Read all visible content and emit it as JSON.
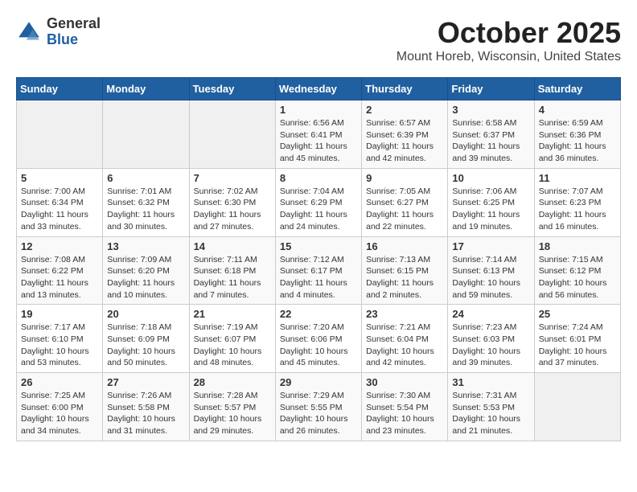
{
  "header": {
    "logo_line1": "General",
    "logo_line2": "Blue",
    "month_title": "October 2025",
    "location": "Mount Horeb, Wisconsin, United States"
  },
  "days_of_week": [
    "Sunday",
    "Monday",
    "Tuesday",
    "Wednesday",
    "Thursday",
    "Friday",
    "Saturday"
  ],
  "weeks": [
    [
      {
        "day": "",
        "info": ""
      },
      {
        "day": "",
        "info": ""
      },
      {
        "day": "",
        "info": ""
      },
      {
        "day": "1",
        "info": "Sunrise: 6:56 AM\nSunset: 6:41 PM\nDaylight: 11 hours\nand 45 minutes."
      },
      {
        "day": "2",
        "info": "Sunrise: 6:57 AM\nSunset: 6:39 PM\nDaylight: 11 hours\nand 42 minutes."
      },
      {
        "day": "3",
        "info": "Sunrise: 6:58 AM\nSunset: 6:37 PM\nDaylight: 11 hours\nand 39 minutes."
      },
      {
        "day": "4",
        "info": "Sunrise: 6:59 AM\nSunset: 6:36 PM\nDaylight: 11 hours\nand 36 minutes."
      }
    ],
    [
      {
        "day": "5",
        "info": "Sunrise: 7:00 AM\nSunset: 6:34 PM\nDaylight: 11 hours\nand 33 minutes."
      },
      {
        "day": "6",
        "info": "Sunrise: 7:01 AM\nSunset: 6:32 PM\nDaylight: 11 hours\nand 30 minutes."
      },
      {
        "day": "7",
        "info": "Sunrise: 7:02 AM\nSunset: 6:30 PM\nDaylight: 11 hours\nand 27 minutes."
      },
      {
        "day": "8",
        "info": "Sunrise: 7:04 AM\nSunset: 6:29 PM\nDaylight: 11 hours\nand 24 minutes."
      },
      {
        "day": "9",
        "info": "Sunrise: 7:05 AM\nSunset: 6:27 PM\nDaylight: 11 hours\nand 22 minutes."
      },
      {
        "day": "10",
        "info": "Sunrise: 7:06 AM\nSunset: 6:25 PM\nDaylight: 11 hours\nand 19 minutes."
      },
      {
        "day": "11",
        "info": "Sunrise: 7:07 AM\nSunset: 6:23 PM\nDaylight: 11 hours\nand 16 minutes."
      }
    ],
    [
      {
        "day": "12",
        "info": "Sunrise: 7:08 AM\nSunset: 6:22 PM\nDaylight: 11 hours\nand 13 minutes."
      },
      {
        "day": "13",
        "info": "Sunrise: 7:09 AM\nSunset: 6:20 PM\nDaylight: 11 hours\nand 10 minutes."
      },
      {
        "day": "14",
        "info": "Sunrise: 7:11 AM\nSunset: 6:18 PM\nDaylight: 11 hours\nand 7 minutes."
      },
      {
        "day": "15",
        "info": "Sunrise: 7:12 AM\nSunset: 6:17 PM\nDaylight: 11 hours\nand 4 minutes."
      },
      {
        "day": "16",
        "info": "Sunrise: 7:13 AM\nSunset: 6:15 PM\nDaylight: 11 hours\nand 2 minutes."
      },
      {
        "day": "17",
        "info": "Sunrise: 7:14 AM\nSunset: 6:13 PM\nDaylight: 10 hours\nand 59 minutes."
      },
      {
        "day": "18",
        "info": "Sunrise: 7:15 AM\nSunset: 6:12 PM\nDaylight: 10 hours\nand 56 minutes."
      }
    ],
    [
      {
        "day": "19",
        "info": "Sunrise: 7:17 AM\nSunset: 6:10 PM\nDaylight: 10 hours\nand 53 minutes."
      },
      {
        "day": "20",
        "info": "Sunrise: 7:18 AM\nSunset: 6:09 PM\nDaylight: 10 hours\nand 50 minutes."
      },
      {
        "day": "21",
        "info": "Sunrise: 7:19 AM\nSunset: 6:07 PM\nDaylight: 10 hours\nand 48 minutes."
      },
      {
        "day": "22",
        "info": "Sunrise: 7:20 AM\nSunset: 6:06 PM\nDaylight: 10 hours\nand 45 minutes."
      },
      {
        "day": "23",
        "info": "Sunrise: 7:21 AM\nSunset: 6:04 PM\nDaylight: 10 hours\nand 42 minutes."
      },
      {
        "day": "24",
        "info": "Sunrise: 7:23 AM\nSunset: 6:03 PM\nDaylight: 10 hours\nand 39 minutes."
      },
      {
        "day": "25",
        "info": "Sunrise: 7:24 AM\nSunset: 6:01 PM\nDaylight: 10 hours\nand 37 minutes."
      }
    ],
    [
      {
        "day": "26",
        "info": "Sunrise: 7:25 AM\nSunset: 6:00 PM\nDaylight: 10 hours\nand 34 minutes."
      },
      {
        "day": "27",
        "info": "Sunrise: 7:26 AM\nSunset: 5:58 PM\nDaylight: 10 hours\nand 31 minutes."
      },
      {
        "day": "28",
        "info": "Sunrise: 7:28 AM\nSunset: 5:57 PM\nDaylight: 10 hours\nand 29 minutes."
      },
      {
        "day": "29",
        "info": "Sunrise: 7:29 AM\nSunset: 5:55 PM\nDaylight: 10 hours\nand 26 minutes."
      },
      {
        "day": "30",
        "info": "Sunrise: 7:30 AM\nSunset: 5:54 PM\nDaylight: 10 hours\nand 23 minutes."
      },
      {
        "day": "31",
        "info": "Sunrise: 7:31 AM\nSunset: 5:53 PM\nDaylight: 10 hours\nand 21 minutes."
      },
      {
        "day": "",
        "info": ""
      }
    ]
  ]
}
